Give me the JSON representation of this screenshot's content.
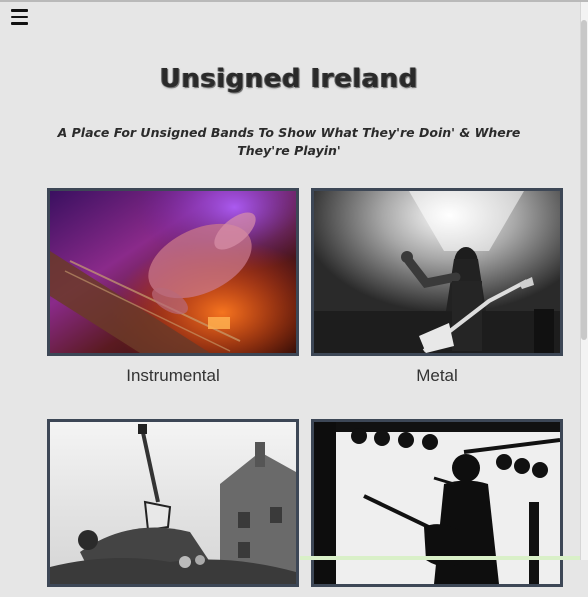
{
  "header": {
    "menu_icon": "hamburger-icon"
  },
  "site": {
    "title": "Unsigned Ireland",
    "tagline": "A Place For Unsigned Bands To Show What They're Doin' & Where They're Playin'"
  },
  "genres": [
    {
      "label": "Instrumental",
      "image": "guitar-closeup-photo"
    },
    {
      "label": "Metal",
      "image": "metal-guitarist-stage-photo"
    },
    {
      "label": "",
      "image": "crowd-surfing-guitarist-photo"
    },
    {
      "label": "",
      "image": "silhouette-guitarist-stage-photo"
    }
  ]
}
